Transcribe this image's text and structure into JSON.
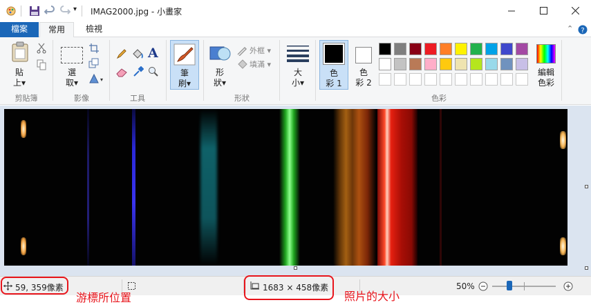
{
  "title": "IMAG2000.jpg - 小畫家",
  "tabs": {
    "file": "檔案",
    "home": "常用",
    "view": "檢視"
  },
  "clipboard": {
    "paste": "貼",
    "paste2": "上▾",
    "label": "剪貼簿"
  },
  "image": {
    "select": "選",
    "select2": "取▾",
    "label": "影像"
  },
  "tools": {
    "label": "工具",
    "text_glyph": "A"
  },
  "brushes": {
    "b1": "筆",
    "b2": "刷▾"
  },
  "shapes": {
    "s1": "形",
    "s2": "狀▾",
    "outline": "外框 ▾",
    "fill": "填滿 ▾",
    "label": "形狀"
  },
  "size": {
    "s1": "大",
    "s2": "小▾"
  },
  "colors": {
    "color1a": "色",
    "color1b": "彩 1",
    "color2a": "色",
    "color2b": "彩 2",
    "edit1": "編輯",
    "edit2": "色彩",
    "label": "色彩",
    "row1": [
      "#000000",
      "#7f7f7f",
      "#880015",
      "#ed1c24",
      "#ff7f27",
      "#fff200",
      "#22b14c",
      "#00a2e8",
      "#3f48cc",
      "#a349a4"
    ],
    "row2": [
      "#ffffff",
      "#c3c3c3",
      "#b97a57",
      "#ffaec9",
      "#ffc90e",
      "#efe4b0",
      "#b5e61d",
      "#99d9ea",
      "#7092be",
      "#c8bfe7"
    ]
  },
  "status": {
    "cursor_pos": "59, 359像素",
    "image_size": "1683 × 458像素",
    "zoom": "50%"
  },
  "annotations": {
    "cursor": "游標所位置",
    "size": "照片的大小"
  },
  "zoom_level": 0.5
}
